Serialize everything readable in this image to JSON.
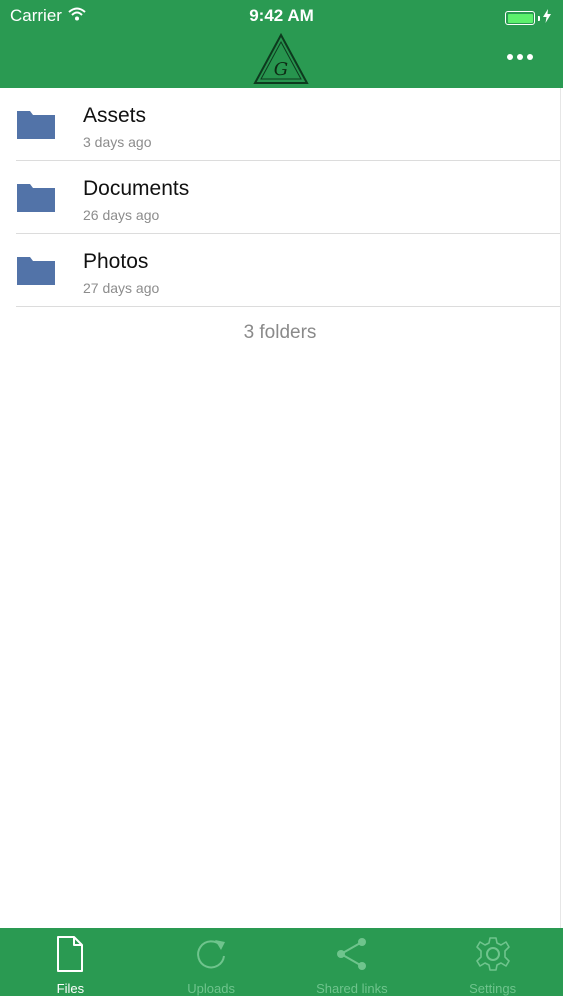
{
  "status_bar": {
    "carrier": "Carrier",
    "time": "9:42 AM",
    "icons": [
      "wifi-icon",
      "battery-icon",
      "charging-bolt-icon"
    ]
  },
  "nav_bar": {
    "logo_letter": "G",
    "actions": [
      "more-options-icon"
    ]
  },
  "folders": [
    {
      "name": "Assets",
      "modified": "3 days ago",
      "icon": "folder-icon"
    },
    {
      "name": "Documents",
      "modified": "26 days ago",
      "icon": "folder-icon"
    },
    {
      "name": "Photos",
      "modified": "27 days ago",
      "icon": "folder-icon"
    }
  ],
  "footer": {
    "count_label": "3 folders"
  },
  "tab_bar": {
    "tabs": [
      {
        "label": "Files",
        "icon": "file-icon",
        "active": true
      },
      {
        "label": "Uploads",
        "icon": "refresh-icon",
        "active": false
      },
      {
        "label": "Shared links",
        "icon": "share-icon",
        "active": false
      },
      {
        "label": "Settings",
        "icon": "gear-icon",
        "active": false
      }
    ]
  },
  "colors": {
    "brand_green": "#2a9a52",
    "folder_blue": "#5273a8",
    "tab_inactive": "#6fc48d",
    "secondary_text": "#8c8c8c"
  }
}
